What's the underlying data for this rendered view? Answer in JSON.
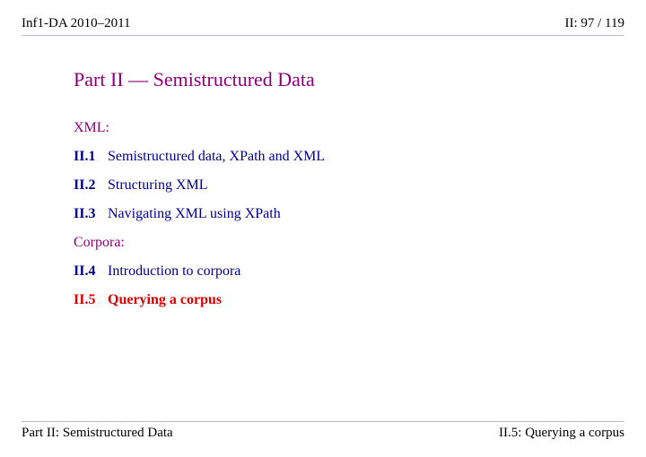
{
  "header": {
    "left": "Inf1-DA 2010–2011",
    "right": "II: 97 / 119"
  },
  "title": "Part II — Semistructured Data",
  "sections": [
    {
      "label": "XML:",
      "items": [
        {
          "num": "II.1",
          "text": "Semistructured data, XPath and XML",
          "current": false
        },
        {
          "num": "II.2",
          "text": "Structuring XML",
          "current": false
        },
        {
          "num": "II.3",
          "text": "Navigating XML using XPath",
          "current": false
        }
      ]
    },
    {
      "label": "Corpora:",
      "items": [
        {
          "num": "II.4",
          "text": "Introduction to corpora",
          "current": false
        },
        {
          "num": "II.5",
          "text": "Querying a corpus",
          "current": true
        }
      ]
    }
  ],
  "footer": {
    "left": "Part II: Semistructured Data",
    "right": "II.5: Querying a corpus"
  }
}
